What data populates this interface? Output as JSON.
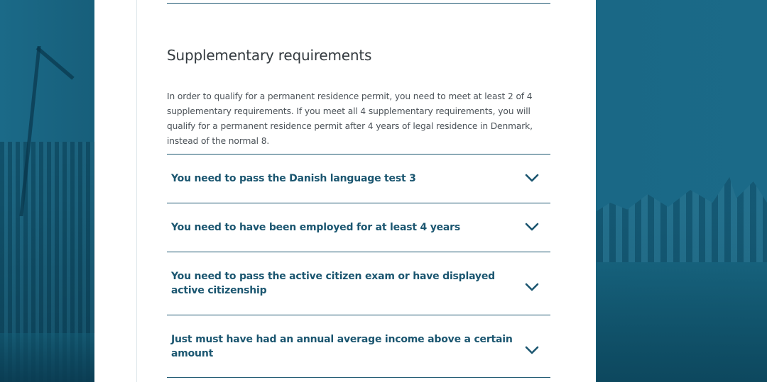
{
  "section": {
    "title": "Supplementary requirements",
    "intro": "In order to qualify for a permanent residence permit, you need to meet at least 2 of 4 supplementary requirements. If you meet all 4 supplementary requirements, you will qualify for a permanent residence permit after 4 years of legal residence in Denmark, instead of the normal 8."
  },
  "requirements": [
    {
      "label": "You need to pass the Danish language test 3",
      "icon": "chevron-down-icon"
    },
    {
      "label": "You need to have been employed for at least 4 years",
      "icon": "chevron-down-icon"
    },
    {
      "label": "You need to pass the active citizen exam or have displayed active citizenship",
      "icon": "chevron-down-icon"
    },
    {
      "label": "Just must have had an annual average income above a certain amount",
      "icon": "chevron-down-icon"
    }
  ],
  "colors": {
    "accent": "#1b5670",
    "background": "#1b6a88",
    "panel": "#ffffff",
    "body_text": "#4b5258"
  }
}
